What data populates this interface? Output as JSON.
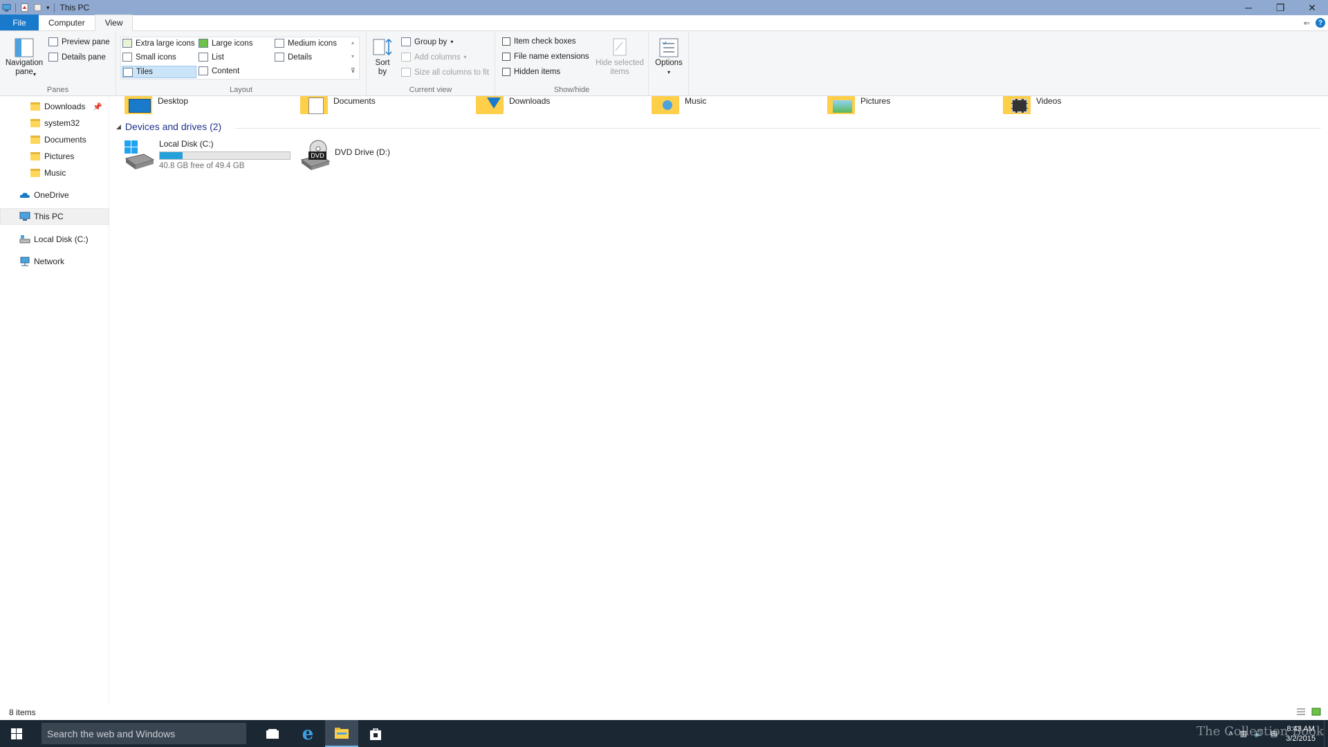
{
  "window": {
    "title": "This PC"
  },
  "tabs": {
    "file": "File",
    "computer": "Computer",
    "view": "View"
  },
  "ribbon": {
    "panes": {
      "navigation_pane": "Navigation",
      "navigation_pane_2": "pane",
      "preview_pane": "Preview pane",
      "details_pane": "Details pane",
      "label": "Panes"
    },
    "layout": {
      "extra_large": "Extra large icons",
      "large": "Large icons",
      "medium": "Medium icons",
      "small": "Small icons",
      "list": "List",
      "details": "Details",
      "tiles": "Tiles",
      "content": "Content",
      "label": "Layout"
    },
    "current_view": {
      "sort_by": "Sort",
      "sort_by_2": "by",
      "group_by": "Group by",
      "add_columns": "Add columns",
      "size_columns": "Size all columns to fit",
      "label": "Current view"
    },
    "show_hide": {
      "item_check_boxes": "Item check boxes",
      "file_name_extensions": "File name extensions",
      "hidden_items": "Hidden items",
      "hide_selected": "Hide selected",
      "hide_selected_2": "items",
      "label": "Show/hide"
    },
    "options": {
      "label": "Options"
    }
  },
  "nav": {
    "items": [
      {
        "label": "Downloads"
      },
      {
        "label": "system32"
      },
      {
        "label": "Documents"
      },
      {
        "label": "Pictures"
      },
      {
        "label": "Music"
      },
      {
        "label": "OneDrive"
      },
      {
        "label": "This PC"
      },
      {
        "label": "Local Disk (C:)"
      },
      {
        "label": "Network"
      }
    ]
  },
  "content": {
    "folders": [
      {
        "label": "Desktop"
      },
      {
        "label": "Documents"
      },
      {
        "label": "Downloads"
      },
      {
        "label": "Music"
      },
      {
        "label": "Pictures"
      },
      {
        "label": "Videos"
      }
    ],
    "devices_header": "Devices and drives (2)",
    "drives": [
      {
        "label": "Local Disk (C:)",
        "free": "40.8 GB free of 49.4 GB",
        "used_fraction": 0.174
      },
      {
        "label": "DVD Drive (D:)",
        "badge": "DVD"
      }
    ]
  },
  "status": {
    "items": "8 items"
  },
  "taskbar": {
    "search_placeholder": "Search the web and Windows",
    "time": "8:43 AM",
    "date": "3/2/2015",
    "watermark": "The Collection Book"
  },
  "colors": {
    "accent": "#1979ca",
    "titlebar": "#8fa9d1",
    "taskbar": "#1b2733",
    "progress": "#26a0da"
  }
}
